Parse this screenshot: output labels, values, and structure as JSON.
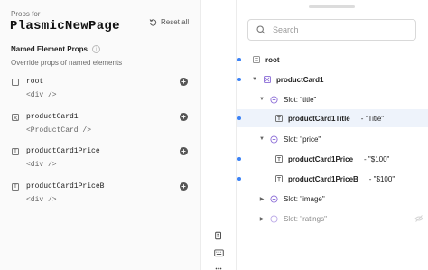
{
  "left_panel": {
    "props_for": "Props for",
    "page_name": "PlasmicNewPage",
    "reset_label": "Reset all",
    "section_title": "Named Element Props",
    "section_subtitle": "Override props of named elements",
    "items": [
      {
        "name": "root",
        "tag": "<div />",
        "icon": "box-icon"
      },
      {
        "name": "productCard1",
        "tag": "<ProductCard />",
        "icon": "component-icon"
      },
      {
        "name": "productCard1Price",
        "tag": "<div />",
        "icon": "text-icon"
      },
      {
        "name": "productCard1PriceB",
        "tag": "<div />",
        "icon": "text-icon"
      }
    ]
  },
  "toolbar": {
    "icons": [
      "layers-icon",
      "keyboard-icon",
      "more-icon"
    ]
  },
  "tree_panel": {
    "search_placeholder": "Search",
    "nodes": [
      {
        "label": "root",
        "hint": "",
        "icon": "frame-icon",
        "bold": true,
        "caret": "none",
        "dot": true
      },
      {
        "label": "productCard1",
        "hint": "",
        "icon": "component-icon",
        "bold": true,
        "caret": "down",
        "dot": true
      },
      {
        "label": "Slot: \"title\"",
        "hint": "",
        "icon": "slot-icon",
        "bold": false,
        "caret": "down",
        "dot": false
      },
      {
        "label": "productCard1Title",
        "hint": "- \"Title\"",
        "icon": "text-icon",
        "bold": true,
        "caret": "none",
        "dot": true,
        "selected": true
      },
      {
        "label": "Slot: \"price\"",
        "hint": "",
        "icon": "slot-icon",
        "bold": false,
        "caret": "down",
        "dot": false
      },
      {
        "label": "productCard1Price",
        "hint": "- \"$100\"",
        "icon": "text-icon",
        "bold": true,
        "caret": "none",
        "dot": true
      },
      {
        "label": "productCard1PriceB",
        "hint": "- \"$100\"",
        "icon": "text-icon",
        "bold": true,
        "caret": "none",
        "dot": true
      },
      {
        "label": "Slot: \"image\"",
        "hint": "",
        "icon": "slot-icon",
        "bold": false,
        "caret": "right",
        "dot": false
      },
      {
        "label": "Slot: \"ratings\"",
        "hint": "",
        "icon": "slot-icon",
        "bold": false,
        "caret": "right",
        "dot": false,
        "strikethrough": true
      }
    ]
  },
  "colors": {
    "accent": "#3b82f6",
    "selected_bg": "#eef3fb",
    "slot_icon": "#8a6bd6"
  }
}
